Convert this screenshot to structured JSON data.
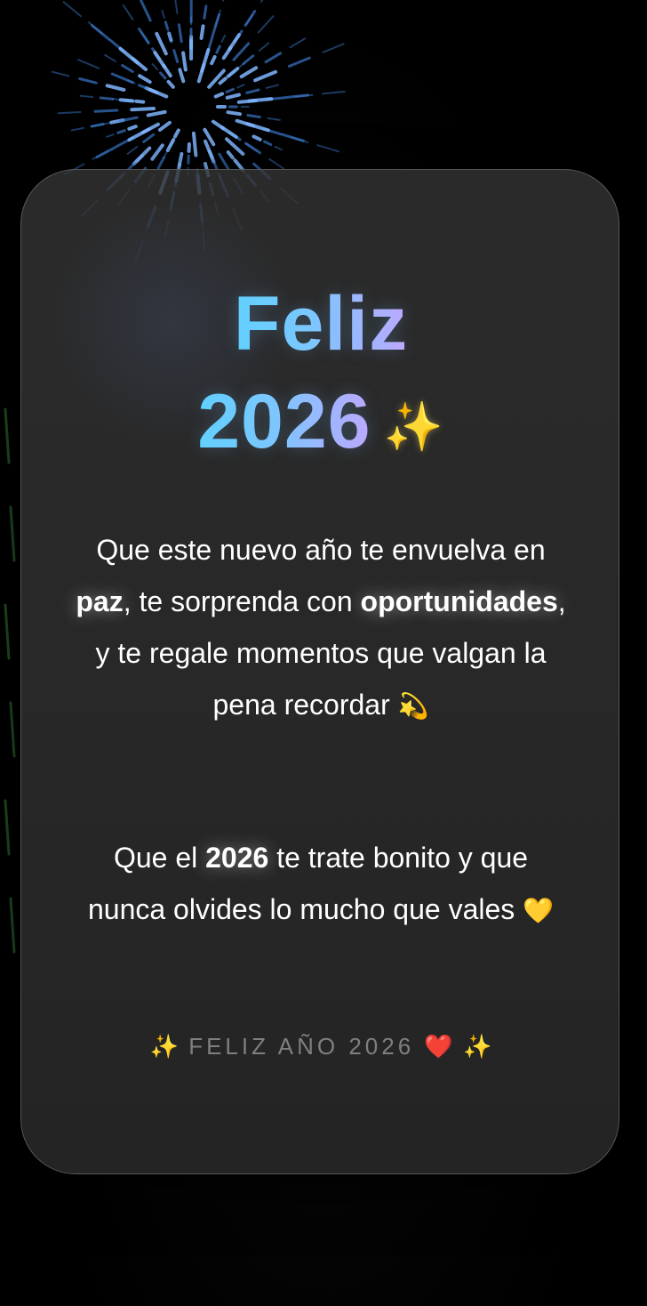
{
  "title": {
    "line1": "Feliz",
    "line2": "2026",
    "sparkle": "✨"
  },
  "message": {
    "p1": {
      "a": "Que este nuevo año te envuelva en ",
      "b": "paz",
      "c": ", te sorprenda con ",
      "d": "oportunidades",
      "e": ", y te regale momentos que valgan la pena recordar ",
      "emoji": "💫"
    },
    "p2": {
      "a": "Que el ",
      "b": "2026",
      "c": " te trate bonito y que nunca olvides lo mucho que vales ",
      "emoji": "💛"
    }
  },
  "footer": {
    "sparkle_left": "✨",
    "text": "FELIZ AÑO 2026",
    "heart": "❤️",
    "sparkle_right": "✨"
  },
  "colors": {
    "background": "#000000",
    "card": "#2e2e2e",
    "gradient_start": "#5fd3ff",
    "gradient_end": "#c6a6ff",
    "footer_text": "#7f7f7f"
  },
  "icons": [
    "firework-decoration",
    "sparkles-icon",
    "dizzy-icon",
    "yellow-heart-icon",
    "red-heart-icon"
  ]
}
